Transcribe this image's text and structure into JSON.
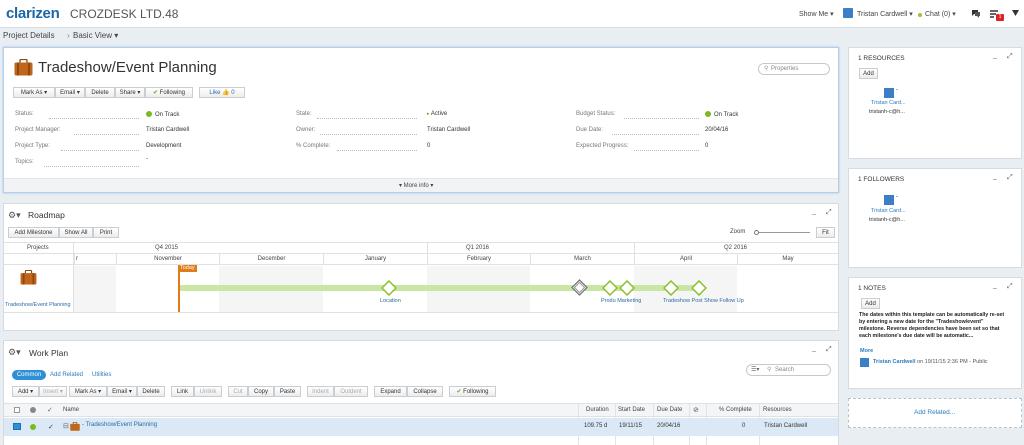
{
  "app": {
    "logo": "clarizen",
    "company": "CROZDESK LTD.48"
  },
  "topnav": {
    "show_me": "Show Me ▾",
    "user": "Tristan Cardwell ▾",
    "chat": "Chat (0) ▾",
    "notif_count": "1"
  },
  "breadcrumb": {
    "item1": "Project Details",
    "sep": "›",
    "item2": "Basic View ▾"
  },
  "project": {
    "title": "Tradeshow/Event Planning",
    "search_placeholder": "Properties",
    "toolbar": {
      "mark_as": "Mark As ▾",
      "email": "Email ▾",
      "delete": "Delete",
      "share": "Share ▾",
      "following": "Following",
      "like": "Like",
      "like_count": "0"
    },
    "fields": {
      "status_label": "Status:",
      "status_value": "On Track",
      "state_label": "State:",
      "state_value": "Active",
      "budget_label": "Budget Status:",
      "budget_value": "On Track",
      "pm_label": "Project Manager:",
      "pm_value": "Tristan Cardwell",
      "owner_label": "Owner:",
      "owner_value": "Tristan Cardwell",
      "due_label": "Due Date:",
      "due_value": "20/04/16",
      "type_label": "Project Type:",
      "type_value": "Development",
      "complete_label": "% Complete:",
      "complete_value": "0",
      "expected_label": "Expected Progress:",
      "expected_value": "0",
      "topics_label": "Topics:",
      "topics_value": "-"
    },
    "more_info": "▾ More info ▾"
  },
  "roadmap": {
    "title": "Roadmap",
    "add_milestone": "Add Milestone",
    "show_all": "Show All",
    "print": "Print",
    "zoom_label": "Zoom",
    "fit": "Fit",
    "projects_header": "Projects",
    "quarters": [
      "Q4 2015",
      "Q1 2016",
      "Q2 2016"
    ],
    "months": [
      "r",
      "November",
      "December",
      "January",
      "February",
      "March",
      "April",
      "May"
    ],
    "today": "Today",
    "project_label": "Tradeshow/Event Planning",
    "milestones": [
      "Location",
      "Produ Marketing",
      "Tradeshow Post Show Follow Up"
    ]
  },
  "workplan": {
    "title": "Work Plan",
    "tabs": {
      "common": "Common",
      "add_related": "Add Related",
      "utilities": "Utilities"
    },
    "search_placeholder": "Search",
    "toolbar": {
      "add": "Add ▾",
      "insert": "Insert ▾",
      "mark_as": "Mark As ▾",
      "email": "Email ▾",
      "delete": "Delete",
      "link": "Link",
      "unlink": "Unlink",
      "cut": "Cut",
      "copy": "Copy",
      "paste": "Paste",
      "indent": "Indent",
      "outdent": "Outdent",
      "expand": "Expand",
      "collapse": "Collapse",
      "following": "Following"
    },
    "columns": {
      "name": "Name",
      "duration": "Duration",
      "start": "Start Date",
      "due": "Due Date",
      "complete": "% Complete",
      "resources": "Resources"
    },
    "row": {
      "name": "Tradeshow/Event Planning",
      "duration": "109.75 d",
      "start": "19/11/15",
      "due": "20/04/16",
      "complete": "0",
      "resources": "Tristan Cardwell"
    }
  },
  "resources": {
    "title": "1 RESOURCES",
    "add": "Add",
    "name": "Tristan Card...",
    "email": "tristanh-c@h..."
  },
  "followers": {
    "title": "1 FOLLOWERS",
    "name": "Tristan Card...",
    "email": "tristanh-c@h..."
  },
  "notes": {
    "title": "1 NOTES",
    "add": "Add",
    "text": "The dates within this template can be automatically re-set by entering a new date for the \"Tradeshow/event\" milestone. Reverse dependencies have been set so that each milestone's due date will be automatic...",
    "more": "More",
    "author": "Tristan Cardwell",
    "meta": "on 19/11/15 2:36 PM - Public"
  },
  "add_related": "Add Related...",
  "colors": {
    "accent": "#1a67a8",
    "green": "#7cba1f",
    "today": "#e07b18",
    "bar": "#c9e6a4"
  }
}
